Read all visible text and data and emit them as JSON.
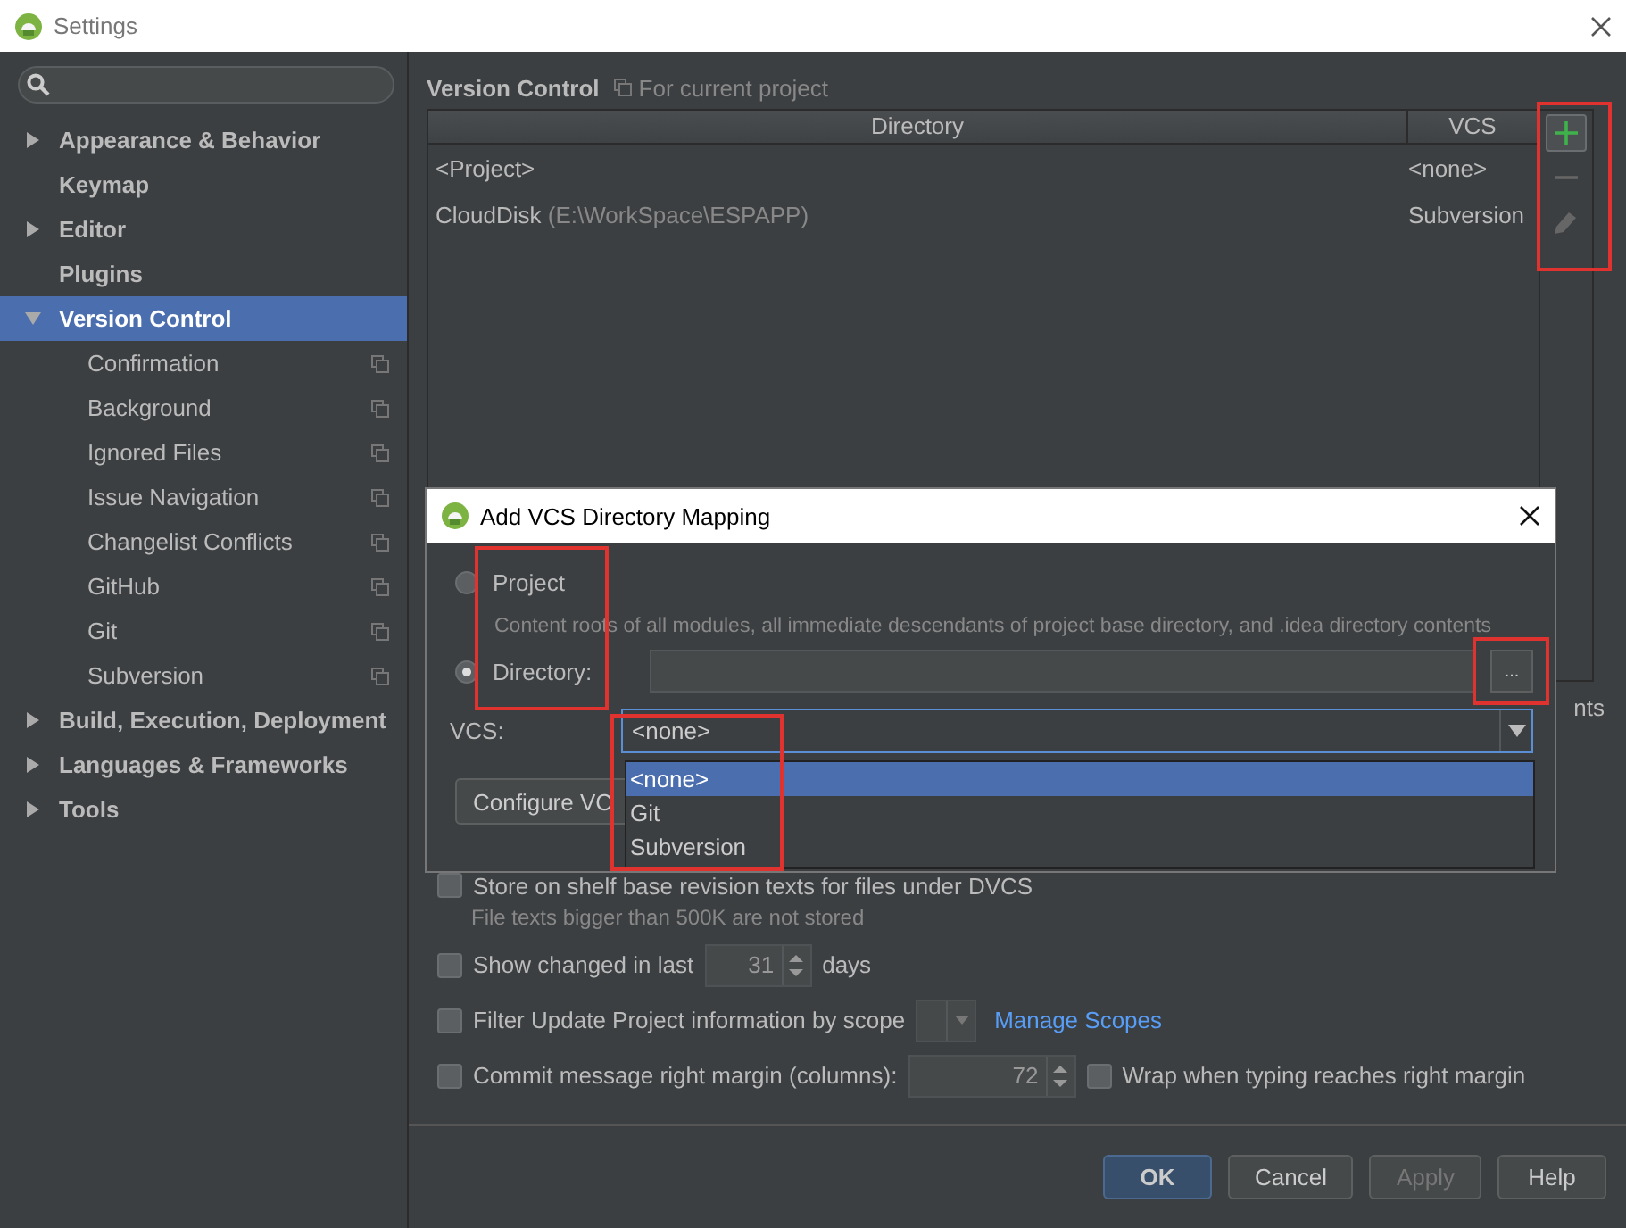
{
  "window": {
    "title": "Settings"
  },
  "sidebar": {
    "items": [
      {
        "label": "Appearance & Behavior",
        "kind": "group",
        "expanded": false,
        "selected": false
      },
      {
        "label": "Keymap",
        "kind": "leaf",
        "selected": false
      },
      {
        "label": "Editor",
        "kind": "group",
        "expanded": false,
        "selected": false
      },
      {
        "label": "Plugins",
        "kind": "leaf",
        "selected": false
      },
      {
        "label": "Version Control",
        "kind": "group",
        "expanded": true,
        "selected": true,
        "children": [
          {
            "label": "Confirmation",
            "kind": "project",
            "selected": false
          },
          {
            "label": "Background",
            "kind": "project",
            "selected": false
          },
          {
            "label": "Ignored Files",
            "kind": "project",
            "selected": false
          },
          {
            "label": "Issue Navigation",
            "kind": "project",
            "selected": false
          },
          {
            "label": "Changelist Conflicts",
            "kind": "project",
            "selected": false
          },
          {
            "label": "GitHub",
            "kind": "project",
            "selected": false
          },
          {
            "label": "Git",
            "kind": "project",
            "selected": false
          },
          {
            "label": "Subversion",
            "kind": "project",
            "selected": false
          }
        ]
      },
      {
        "label": "Build, Execution, Deployment",
        "kind": "group",
        "expanded": false,
        "selected": false
      },
      {
        "label": "Languages & Frameworks",
        "kind": "group",
        "expanded": false,
        "selected": false
      },
      {
        "label": "Tools",
        "kind": "group",
        "expanded": false,
        "selected": false
      }
    ]
  },
  "page": {
    "title": "Version Control",
    "scope_note": "For current project"
  },
  "table": {
    "columns": [
      "Directory",
      "VCS"
    ],
    "rows": [
      {
        "name": "<Project>",
        "vcs": "<none>"
      },
      {
        "name": "CloudDisk",
        "path": "(E:\\WorkSpace\\ESPAPP)",
        "vcs": "Subversion"
      }
    ]
  },
  "toolbar": [
    {
      "kind": "add",
      "disabled": false
    },
    {
      "kind": "remove",
      "disabled": true
    },
    {
      "kind": "edit",
      "disabled": true
    }
  ],
  "covered_fragment": "nts",
  "options": [
    {
      "kind": "checkbox",
      "label": "Store on shelf base revision texts for files under DVCS",
      "checked": false,
      "note": "File texts bigger than 500K are not stored"
    },
    {
      "kind": "spinner",
      "label": "Show changed in last",
      "checked": false,
      "value": "31",
      "suffix": "days"
    },
    {
      "kind": "scope",
      "label": "Filter Update Project information by scope",
      "checked": false,
      "link": "Manage Scopes"
    },
    {
      "kind": "margin",
      "label": "Commit message right margin (columns):",
      "checked": false,
      "value": "72",
      "extra": {
        "label": "Wrap when typing reaches right margin",
        "checked": false
      }
    }
  ],
  "buttons": [
    {
      "label": "OK",
      "kind": "default",
      "disabled": false
    },
    {
      "label": "Cancel",
      "kind": "normal",
      "disabled": false
    },
    {
      "label": "Apply",
      "kind": "normal",
      "disabled": true
    },
    {
      "label": "Help",
      "kind": "normal",
      "disabled": false
    }
  ],
  "dialog": {
    "title": "Add VCS Directory Mapping",
    "radios": [
      {
        "label": "Project",
        "selected": false
      },
      {
        "label": "Directory:",
        "selected": true
      }
    ],
    "description": "Content roots of all modules, all immediate descendants of project base directory, and .idea directory contents",
    "browse_button": "...",
    "vcs_label": "VCS:",
    "vcs_value": "<none>",
    "dropdown": [
      {
        "label": "<none>",
        "selected": true
      },
      {
        "label": "Git",
        "selected": false
      },
      {
        "label": "Subversion",
        "selected": false
      }
    ],
    "configure_button": "Configure VC"
  },
  "annotation_frames": [
    {
      "kind": "frame"
    },
    {
      "kind": "frame"
    },
    {
      "kind": "frame"
    },
    {
      "kind": "frame"
    }
  ]
}
